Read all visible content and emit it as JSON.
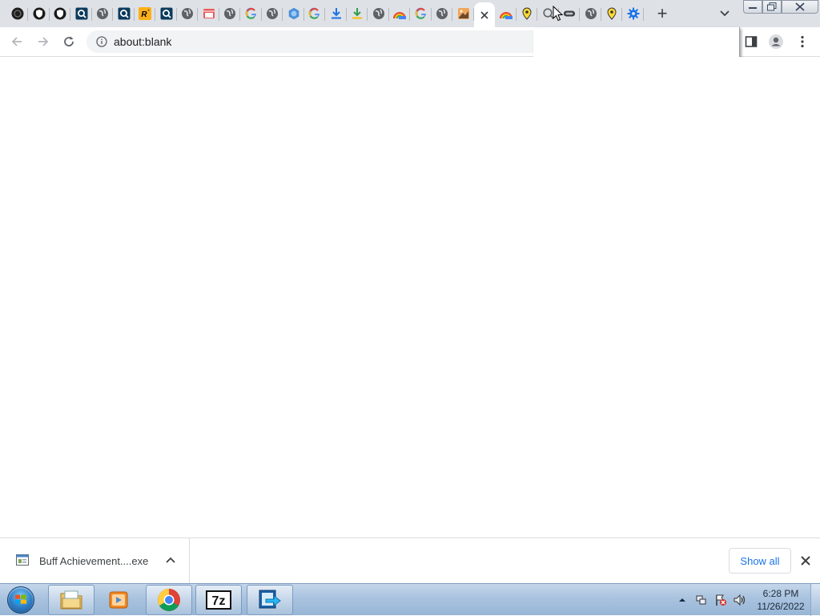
{
  "browser": {
    "tabs": [
      {
        "icon": "dark-circle-icon"
      },
      {
        "icon": "shield-icon"
      },
      {
        "icon": "shield-icon"
      },
      {
        "icon": "search-box-icon"
      },
      {
        "icon": "globe-icon"
      },
      {
        "icon": "search-box-icon"
      },
      {
        "icon": "rockstar-icon"
      },
      {
        "icon": "search-box-icon"
      },
      {
        "icon": "globe-icon"
      },
      {
        "icon": "store-icon"
      },
      {
        "icon": "globe-icon"
      },
      {
        "icon": "google-icon"
      },
      {
        "icon": "globe-icon"
      },
      {
        "icon": "hexagon-icon"
      },
      {
        "icon": "google-icon"
      },
      {
        "icon": "download-icon"
      },
      {
        "icon": "download-green-icon"
      },
      {
        "icon": "globe-icon"
      },
      {
        "icon": "rainbow-icon"
      },
      {
        "icon": "google-icon"
      },
      {
        "icon": "globe-icon"
      },
      {
        "icon": "photo-icon"
      },
      {
        "icon": "close-icon",
        "active": true
      },
      {
        "icon": "rainbow-icon"
      },
      {
        "icon": "map-pin-icon"
      },
      {
        "icon": "search-icon"
      },
      {
        "icon": "link-icon"
      },
      {
        "icon": "globe-icon"
      },
      {
        "icon": "map-pin-icon"
      },
      {
        "icon": "gear-icon"
      }
    ],
    "address": {
      "url": "about:blank"
    },
    "colors": {
      "accent": "#1a73e8",
      "tabstrip": "#dee1e6"
    }
  },
  "downloads": {
    "file_name": "Buff Achievement....exe",
    "show_all_label": "Show all"
  },
  "taskbar": {
    "apps": [
      "windows-explorer",
      "media-player",
      "chrome",
      "7-zip",
      "remote-app"
    ],
    "clock": {
      "time": "6:28 PM",
      "date": "11/26/2022"
    }
  }
}
